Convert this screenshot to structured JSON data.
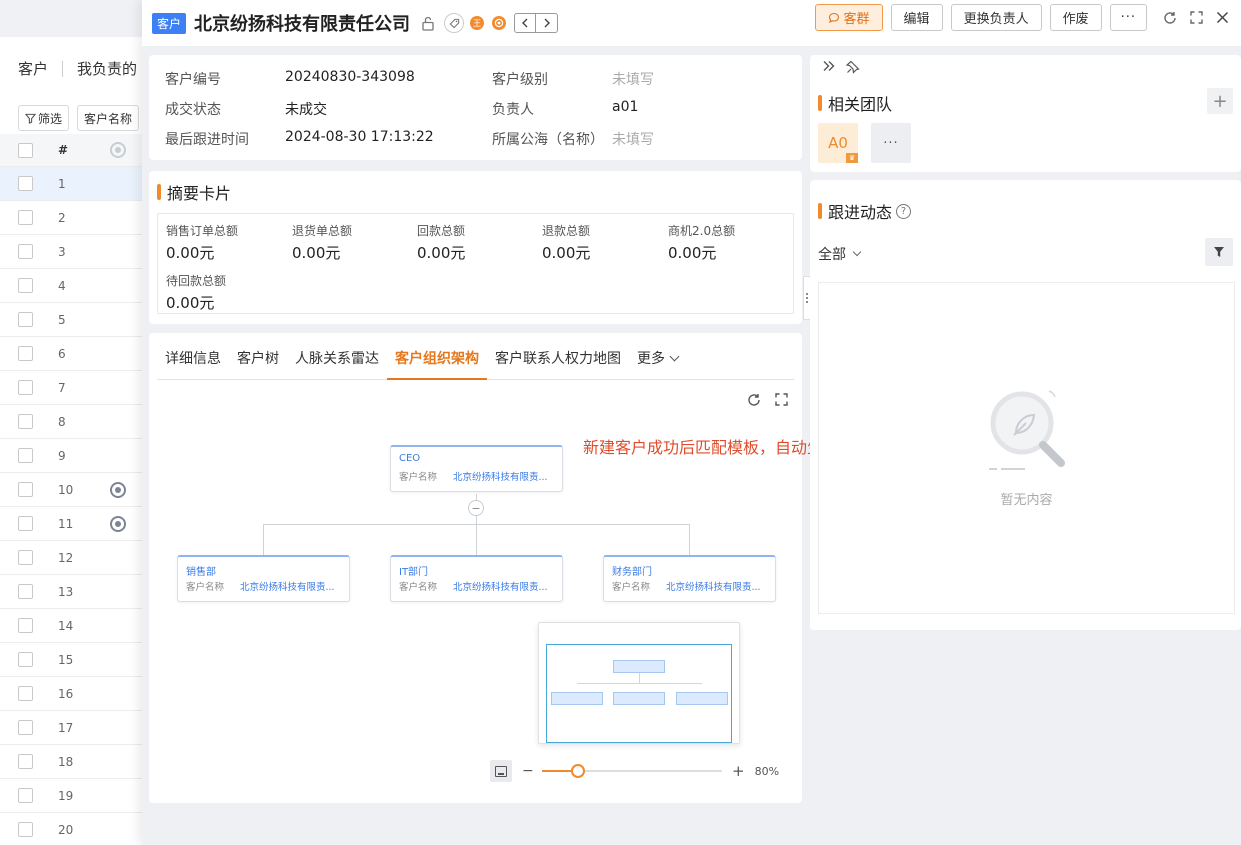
{
  "background_list": {
    "tab_customers": "客户",
    "tab_mine": "我负责的",
    "filter_label": "筛选",
    "field_label": "客户名称",
    "header_num": "#",
    "rows": [
      "1",
      "2",
      "3",
      "4",
      "5",
      "6",
      "7",
      "8",
      "9",
      "10",
      "11",
      "12",
      "13",
      "14",
      "15",
      "16",
      "17",
      "18",
      "19",
      "20"
    ]
  },
  "header": {
    "tag": "客户",
    "title": "北京纷扬科技有限责任公司",
    "badge_tax": "王",
    "actions": {
      "group": "客群",
      "edit": "编辑",
      "change_owner": "更换负责人",
      "void": "作废",
      "more": "···"
    }
  },
  "info": {
    "customer_no_label": "客户编号",
    "customer_no": "20240830-343098",
    "level_label": "客户级别",
    "level": "未填写",
    "deal_status_label": "成交状态",
    "deal_status": "未成交",
    "owner_label": "负责人",
    "owner": "a01",
    "last_follow_label": "最后跟进时间",
    "last_follow": "2024-08-30 17:13:22",
    "pool_label": "所属公海（名称）",
    "pool": "未填写"
  },
  "summary": {
    "title": "摘要卡片",
    "items": [
      {
        "label": "销售订单总额",
        "value": "0.00元"
      },
      {
        "label": "退货单总额",
        "value": "0.00元"
      },
      {
        "label": "回款总额",
        "value": "0.00元"
      },
      {
        "label": "退款总额",
        "value": "0.00元"
      },
      {
        "label": "商机2.0总额",
        "value": "0.00元"
      },
      {
        "label": "待回款总额",
        "value": "0.00元"
      }
    ]
  },
  "tabs": {
    "detail": "详细信息",
    "tree": "客户树",
    "radar": "人脉关系雷达",
    "org": "客户组织架构",
    "power_map": "客户联系人权力地图",
    "more": "更多"
  },
  "org": {
    "annotation": "新建客户成功后匹配模板，自动生成组织架构",
    "field_label": "客户名称",
    "field_value": "北京纷扬科技有限责...",
    "root": "CEO",
    "children": [
      "销售部",
      "IT部门",
      "财务部门"
    ],
    "toggle": "−",
    "zoom_minus": "−",
    "zoom_plus": "+",
    "zoom_percent": "80%",
    "zoom_value": 0.2
  },
  "team": {
    "title": "相关团队",
    "add": "+",
    "member": "A0",
    "more": "···"
  },
  "follow": {
    "title": "跟进动态",
    "help": "?",
    "filter": "全部",
    "empty": "暂无内容"
  }
}
